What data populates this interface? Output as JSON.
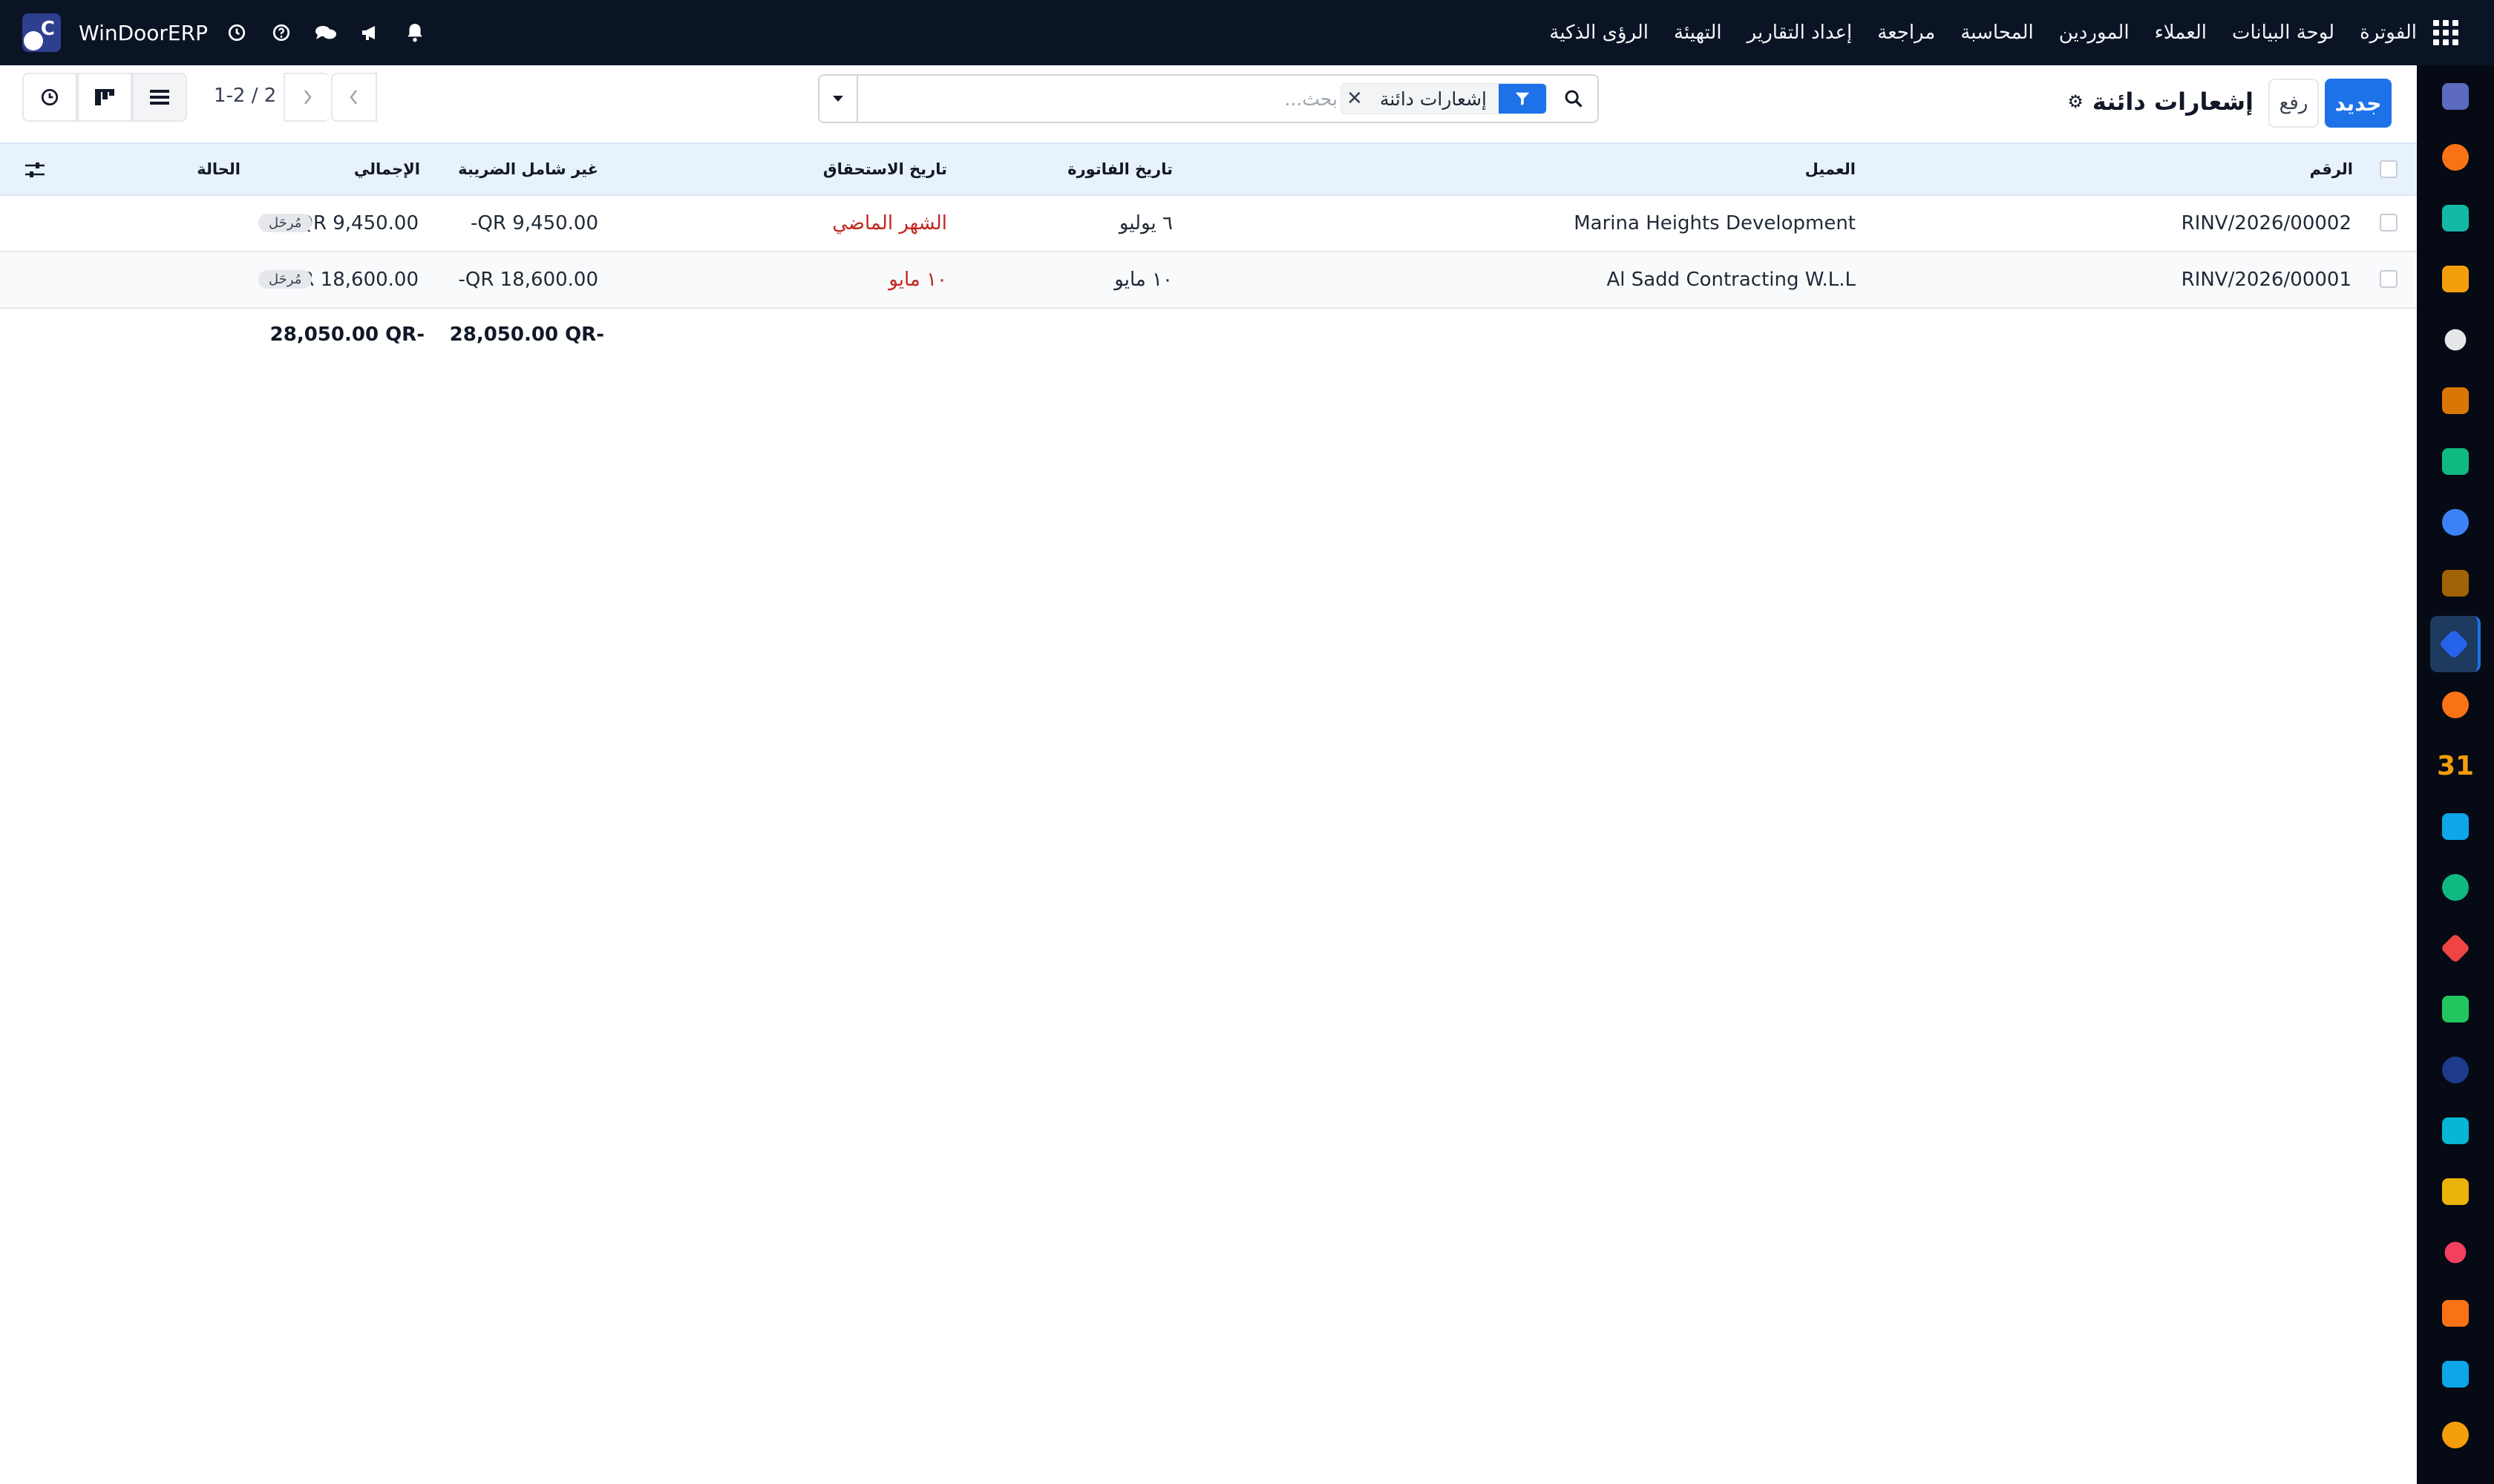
{
  "navbar": {
    "brand": "WinDoorERP",
    "menu": [
      "الفوترة",
      "لوحة البيانات",
      "العملاء",
      "الموردين",
      "المحاسبة",
      "مراجعة",
      "إعداد التقارير",
      "التهيئة",
      "الرؤى الذكية"
    ],
    "icons": [
      "apps-grid-icon",
      "bell-icon",
      "megaphone-icon",
      "chat-icon",
      "help-icon",
      "clock-icon"
    ]
  },
  "control": {
    "new_label": "جديد",
    "upload_label": "رفع",
    "title": "إشعارات دائنة",
    "search_facet": "إشعارات دائنة",
    "search_placeholder": "بحث...",
    "pager": "1-2 / 2"
  },
  "table": {
    "headers": {
      "number": "الرقم",
      "customer": "العميل",
      "invoice_date": "تاريخ الفاتورة",
      "due_date": "تاريخ الاستحقاق",
      "untaxed": "غير شامل الضريبة",
      "total": "الإجمالي",
      "status": "الحالة"
    },
    "rows": [
      {
        "number": "RINV/2026/00002",
        "customer": "Marina Heights Development",
        "invoice_date": "٦ يوليو",
        "due_date": "الشهر الماضي",
        "untaxed": "9,450.00 QR-",
        "total": "9,450.00 QR-",
        "status": "مُرحَل"
      },
      {
        "number": "RINV/2026/00001",
        "customer": "Al Sadd Contracting W.L.L",
        "invoice_date": "١٠ مايو",
        "due_date": "١٠ مايو",
        "untaxed": "18,600.00 QR-",
        "total": "18,600.00 QR-",
        "status": "مُرحَل"
      }
    ],
    "totals": {
      "untaxed": "28,050.00 QR-",
      "total": "28,050.00 QR-"
    }
  },
  "sidebar": {
    "apps": [
      {
        "icon": "mail-app-icon",
        "color": "#5c6bc0"
      },
      {
        "icon": "discuss-app-icon",
        "color": "#f97316"
      },
      {
        "icon": "inventory-app-icon",
        "color": "#14b8a6"
      },
      {
        "icon": "reports-app-icon",
        "color": "#f59e0b"
      },
      {
        "icon": "cube-app-icon",
        "color": "#e5e7eb"
      },
      {
        "icon": "photos-app-icon",
        "color": "#d97706"
      },
      {
        "icon": "tasks-app-icon",
        "color": "#10b981"
      },
      {
        "icon": "knowledge-app-icon",
        "color": "#3b82f6"
      },
      {
        "icon": "package-app-icon",
        "color": "#a16207"
      },
      {
        "icon": "invoicing-app-icon",
        "color": "#2563eb"
      },
      {
        "icon": "employees-app-icon",
        "color": "#f97316"
      },
      {
        "icon": "calendar-app-icon",
        "color": "#f59e0b",
        "text": "31"
      },
      {
        "icon": "sign-app-icon",
        "color": "#0ea5e9"
      },
      {
        "icon": "contacts-app-icon",
        "color": "#10b981"
      },
      {
        "icon": "dashboards-app-icon",
        "color": "#ef4444"
      },
      {
        "icon": "whatsapp-app-icon",
        "color": "#22c55e"
      },
      {
        "icon": "time-app-icon",
        "color": "#1e3a8a"
      },
      {
        "icon": "website-app-icon",
        "color": "#06b6d4"
      },
      {
        "icon": "telegram-app-icon",
        "color": "#eab308"
      },
      {
        "icon": "payroll-app-icon",
        "color": "#f43f5e"
      },
      {
        "icon": "manufacturing-app-icon",
        "color": "#f97316"
      },
      {
        "icon": "analytics-app-icon",
        "color": "#0ea5e9"
      },
      {
        "icon": "settings-app-icon",
        "color": "#f59e0b"
      }
    ]
  }
}
